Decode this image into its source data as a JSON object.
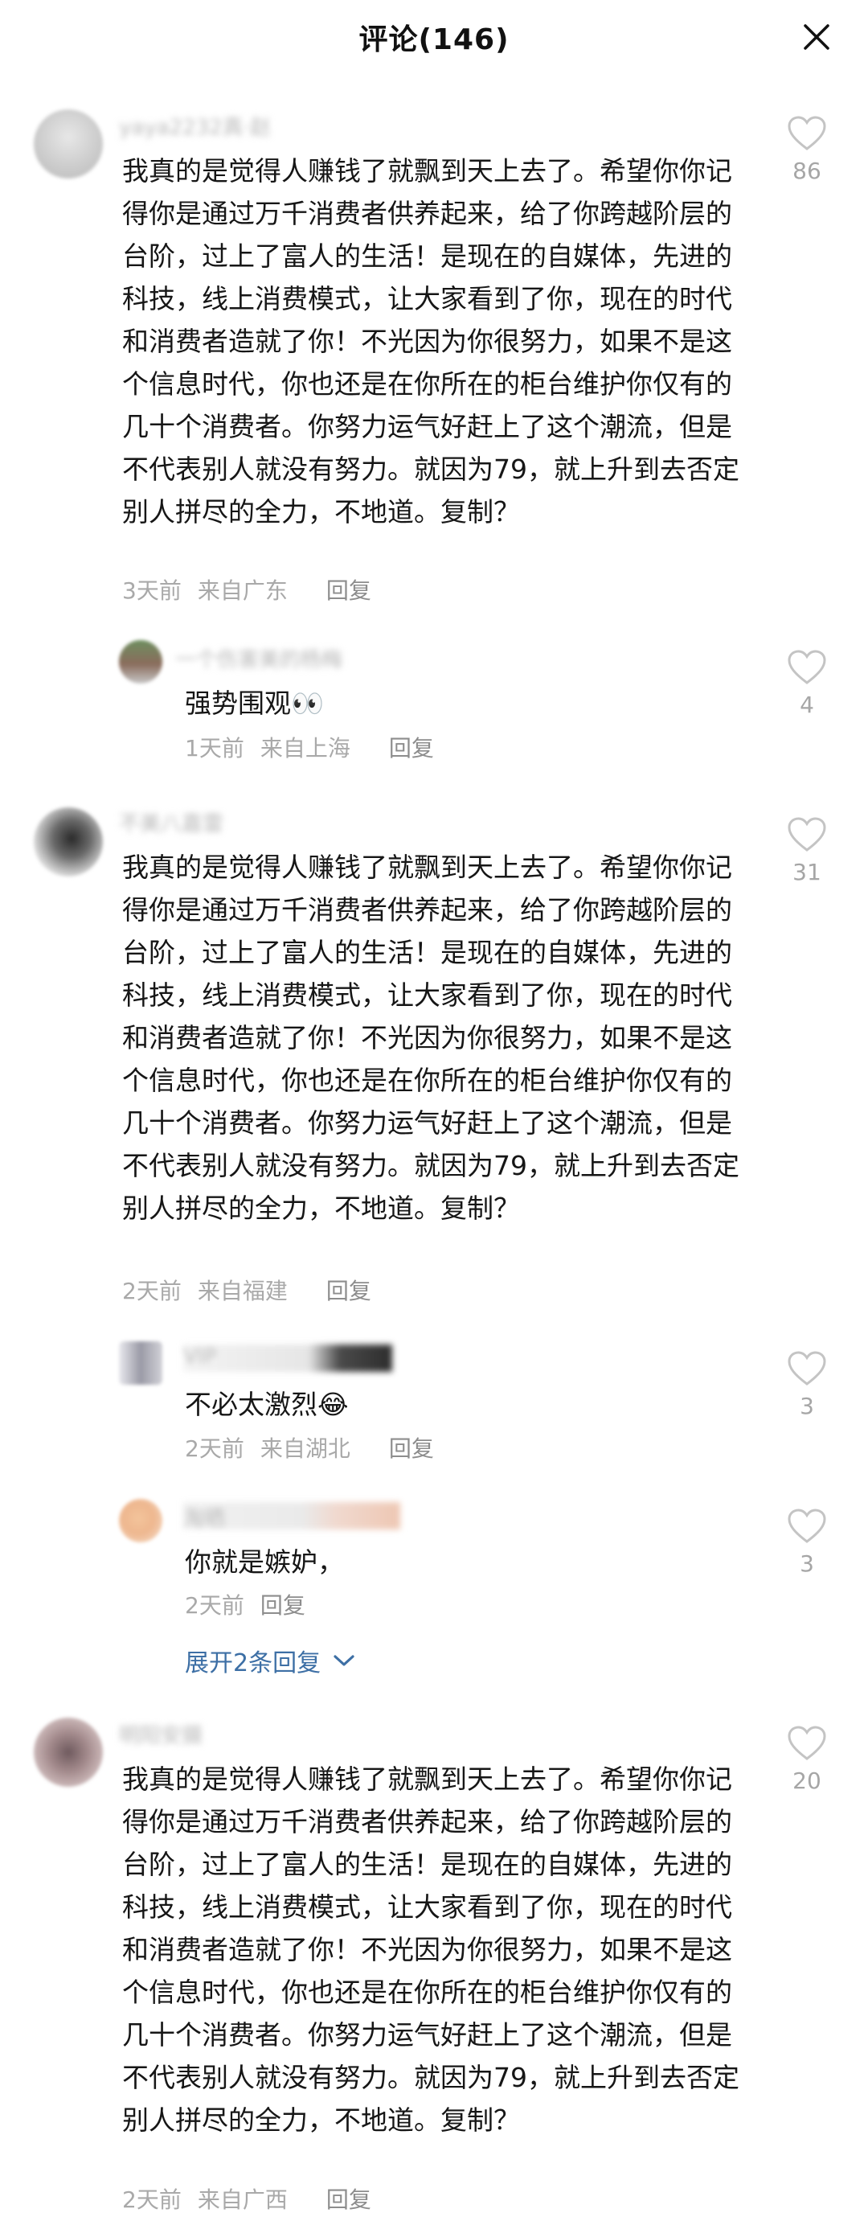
{
  "header": {
    "title": "评论(146)"
  },
  "comments": [
    {
      "username": "yaya2232真·赵",
      "text": "我真的是觉得人赚钱了就飘到天上去了。希望你你记得你是通过万千消费者供养起来，给了你跨越阶层的台阶，过上了富人的生活！是现在的自媒体，先进的科技，线上消费模式，让大家看到了你，现在的时代和消费者造就了你！不光因为你很努力，如果不是这个信息时代，你也还是在你所在的柜台维护你仅有的几十个消费者。你努力运气好赶上了这个潮流，但是不代表别人就没有努力。就因为79，就上升到去否定别人拼尽的全力，不地道。复制？",
      "time": "3天前",
      "location": "来自广东",
      "reply": "回复",
      "likes": "86"
    },
    {
      "username": "一个伤害美的杨梅",
      "text": "强势围观👀",
      "time": "1天前",
      "location": "来自上海",
      "reply": "回复",
      "likes": "4"
    },
    {
      "username": "不美八嘉雷",
      "text": "我真的是觉得人赚钱了就飘到天上去了。希望你你记得你是通过万千消费者供养起来，给了你跨越阶层的台阶，过上了富人的生活！是现在的自媒体，先进的科技，线上消费模式，让大家看到了你，现在的时代和消费者造就了你！不光因为你很努力，如果不是这个信息时代，你也还是在你所在的柜台维护你仅有的几十个消费者。你努力运气好赶上了这个潮流，但是不代表别人就没有努力。就因为79，就上升到去否定别人拼尽的全力，不地道。复制？",
      "time": "2天前",
      "location": "来自福建",
      "reply": "回复",
      "likes": "31"
    },
    {
      "username": "VIP",
      "text": "不必太激烈😂",
      "time": "2天前",
      "location": "来自湖北",
      "reply": "回复",
      "likes": "3"
    },
    {
      "username": "淘晒",
      "text": "你就是嫉妒，",
      "time": "2天前",
      "location": "",
      "reply": "回复",
      "likes": "3"
    },
    {
      "username": "明阳安摄",
      "text": "我真的是觉得人赚钱了就飘到天上去了。希望你你记得你是通过万千消费者供养起来，给了你跨越阶层的台阶，过上了富人的生活！是现在的自媒体，先进的科技，线上消费模式，让大家看到了你，现在的时代和消费者造就了你！不光因为你很努力，如果不是这个信息时代，你也还是在你所在的柜台维护你仅有的几十个消费者。你努力运气好赶上了这个潮流，但是不代表别人就没有努力。就因为79，就上升到去否定别人拼尽的全力，不地道。复制？",
      "time": "2天前",
      "location": "来自广西",
      "reply": "回复",
      "likes": "20"
    }
  ],
  "expand": {
    "label": "展开2条回复"
  },
  "colors": {
    "link": "#3d6fa5",
    "meta": "#a9a9a9",
    "icon": "#c4c4c4"
  },
  "icons": [
    "close-icon",
    "heart-icon",
    "chevron-down-icon"
  ]
}
